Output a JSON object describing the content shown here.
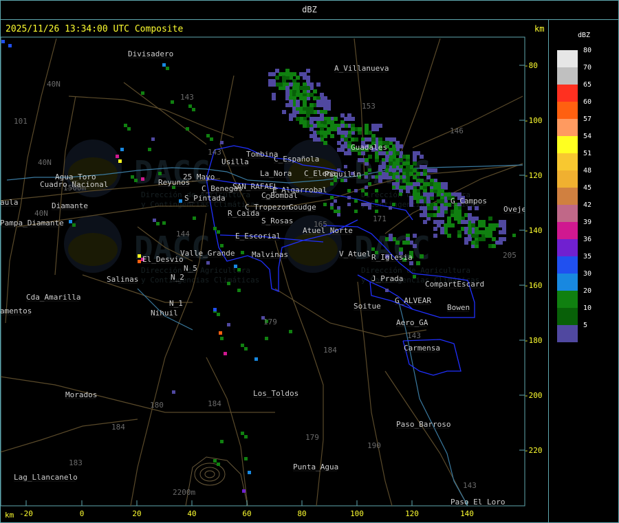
{
  "header": {
    "product_label": "dBZ",
    "timestamp": "2025/11/26 13:34:00 UTC Composite",
    "km_unit_top": "km",
    "km_unit_bottom": "km"
  },
  "y_axis": {
    "ticks": [
      "-80",
      "-100",
      "-120",
      "-140",
      "-160",
      "-180",
      "-200",
      "-220"
    ]
  },
  "x_axis": {
    "ticks": [
      "-20",
      "0",
      "20",
      "40",
      "60",
      "80",
      "100",
      "120",
      "140"
    ]
  },
  "legend": {
    "title": "dBZ",
    "entries": [
      {
        "value": "80",
        "color": "#e6e6e6"
      },
      {
        "value": "70",
        "color": "#c0c0c0"
      },
      {
        "value": "65",
        "color": "#ff3020"
      },
      {
        "value": "60",
        "color": "#ff6010"
      },
      {
        "value": "57",
        "color": "#ff9a60"
      },
      {
        "value": "54",
        "color": "#ffff20"
      },
      {
        "value": "51",
        "color": "#f8c830"
      },
      {
        "value": "48",
        "color": "#f0b030"
      },
      {
        "value": "45",
        "color": "#d08040"
      },
      {
        "value": "42",
        "color": "#c06888"
      },
      {
        "value": "39",
        "color": "#d01890"
      },
      {
        "value": "36",
        "color": "#7020d0"
      },
      {
        "value": "35",
        "color": "#2050f0"
      },
      {
        "value": "30",
        "color": "#1888e0"
      },
      {
        "value": "20",
        "color": "#108010"
      },
      {
        "value": "10",
        "color": "#086008"
      },
      {
        "value": "5",
        "color": "#5048a0"
      }
    ]
  },
  "places": [
    {
      "name": "Divisadero"
    },
    {
      "name": "A_Villanueva"
    },
    {
      "name": "Guadales"
    },
    {
      "name": "Tombina"
    },
    {
      "name": "Usilla"
    },
    {
      "name": "C_Española"
    },
    {
      "name": "Agua_Toro"
    },
    {
      "name": "Cuadro_Nacional"
    },
    {
      "name": "Reyunos"
    },
    {
      "name": "25_Mayo"
    },
    {
      "name": "C_Benegas"
    },
    {
      "name": "SAN_RAFAEL"
    },
    {
      "name": "La_Nora"
    },
    {
      "name": "C_Elena"
    },
    {
      "name": "Piquilin"
    },
    {
      "name": "G_Campos"
    },
    {
      "name": "S_Pintada"
    },
    {
      "name": "E_Algarrobal"
    },
    {
      "name": "C_Bombal"
    },
    {
      "name": "C_Tropezon"
    },
    {
      "name": "Goudge"
    },
    {
      "name": "Pampa_Diamante"
    },
    {
      "name": "R_Caida"
    },
    {
      "name": "S_Rosas"
    },
    {
      "name": "Atuel_Norte"
    },
    {
      "name": "E_Escorial"
    },
    {
      "name": "Valle_Grande"
    },
    {
      "name": "Malvinas"
    },
    {
      "name": "V_Atuel"
    },
    {
      "name": "R_Iglesia"
    },
    {
      "name": "El_Desvio"
    },
    {
      "name": "N_5"
    },
    {
      "name": "N_2"
    },
    {
      "name": "Salinas"
    },
    {
      "name": "J_Prada"
    },
    {
      "name": "CompartEscard"
    },
    {
      "name": "Cda_Amarilla"
    },
    {
      "name": "N_1"
    },
    {
      "name": "Nihuil"
    },
    {
      "name": "G_ALVEAR"
    },
    {
      "name": "Soitue"
    },
    {
      "name": "Bowen"
    },
    {
      "name": "Aero_GA"
    },
    {
      "name": "Carmensa"
    },
    {
      "name": "Morados"
    },
    {
      "name": "Los_Toldos"
    },
    {
      "name": "Paso_Barroso"
    },
    {
      "name": "Punta_Agua"
    },
    {
      "name": "Lag_Llancanelo"
    },
    {
      "name": "Paso_El_Loro"
    },
    {
      "name": "Oveje"
    },
    {
      "name": "aula"
    },
    {
      "name": "amentos"
    },
    {
      "name": "Diamante"
    }
  ],
  "route_labels": [
    "40N",
    "40N",
    "40N",
    "101",
    "143",
    "143",
    "153",
    "146",
    "144",
    "171",
    "179",
    "184",
    "180",
    "184",
    "183",
    "184",
    "179",
    "190",
    "143",
    "143",
    "205",
    "165",
    "1500m",
    "2200m"
  ],
  "watermark": {
    "brand": "DACC",
    "line1": "Dirección de Agricultura",
    "line2": "y Contingencias Climáticas"
  }
}
